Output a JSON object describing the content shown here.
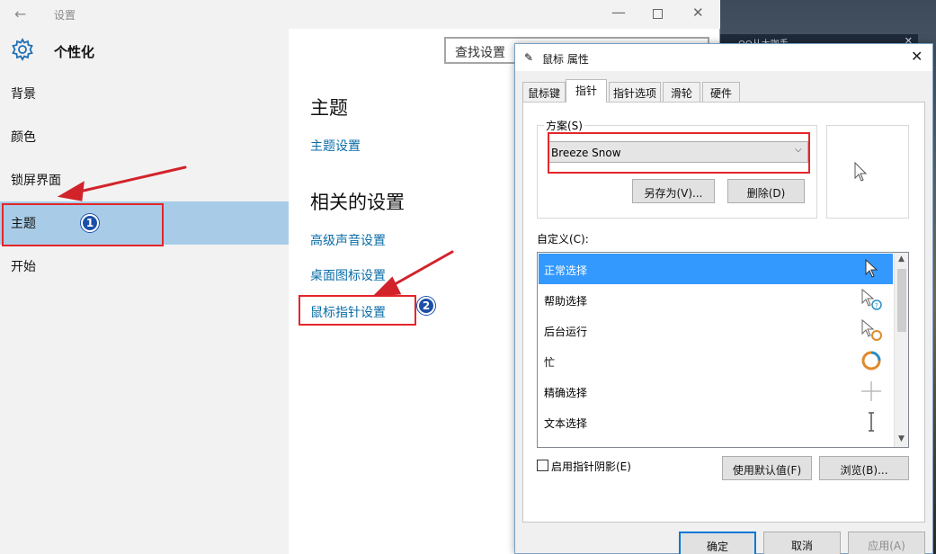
{
  "settings": {
    "window_title": "设置",
    "header_title": "个性化",
    "search_placeholder": "查找设置",
    "nav": [
      "背景",
      "颜色",
      "锁屏界面",
      "主题",
      "开始"
    ],
    "content": {
      "heading_theme": "主题",
      "link_theme_settings": "主题设置",
      "heading_related": "相关的设置",
      "link_sound": "高级声音设置",
      "link_desktop_icons": "桌面图标设置",
      "link_mouse_pointer": "鼠标指针设置"
    }
  },
  "background_window": {
    "title": "QQ从大咖手"
  },
  "annotations": {
    "badge1": "1",
    "badge2": "2",
    "color": "#e3262a"
  },
  "dialog": {
    "title": "鼠标 属性",
    "tabs": [
      "鼠标键",
      "指针",
      "指针选项",
      "滑轮",
      "硬件"
    ],
    "active_tab": "指针",
    "scheme_label": "方案(S)",
    "scheme_value": "Breeze Snow",
    "save_as": "另存为(V)...",
    "delete": "删除(D)",
    "custom_label": "自定义(C):",
    "pointers": [
      {
        "label": "正常选择",
        "icon": "arrow-cursor-icon"
      },
      {
        "label": "帮助选择",
        "icon": "help-cursor-icon"
      },
      {
        "label": "后台运行",
        "icon": "working-cursor-icon"
      },
      {
        "label": "忙",
        "icon": "busy-cursor-icon"
      },
      {
        "label": "精确选择",
        "icon": "crosshair-cursor-icon"
      },
      {
        "label": "文本选择",
        "icon": "text-cursor-icon"
      }
    ],
    "shadow_label": "启用指针阴影(E)",
    "use_default": "使用默认值(F)",
    "browse": "浏览(B)...",
    "ok": "确定",
    "cancel": "取消",
    "apply": "应用(A)"
  },
  "colors": {
    "accent": "#0078d7",
    "selection": "#3399ff",
    "nav_active": "#a8cce8",
    "link": "#0a6da8"
  }
}
